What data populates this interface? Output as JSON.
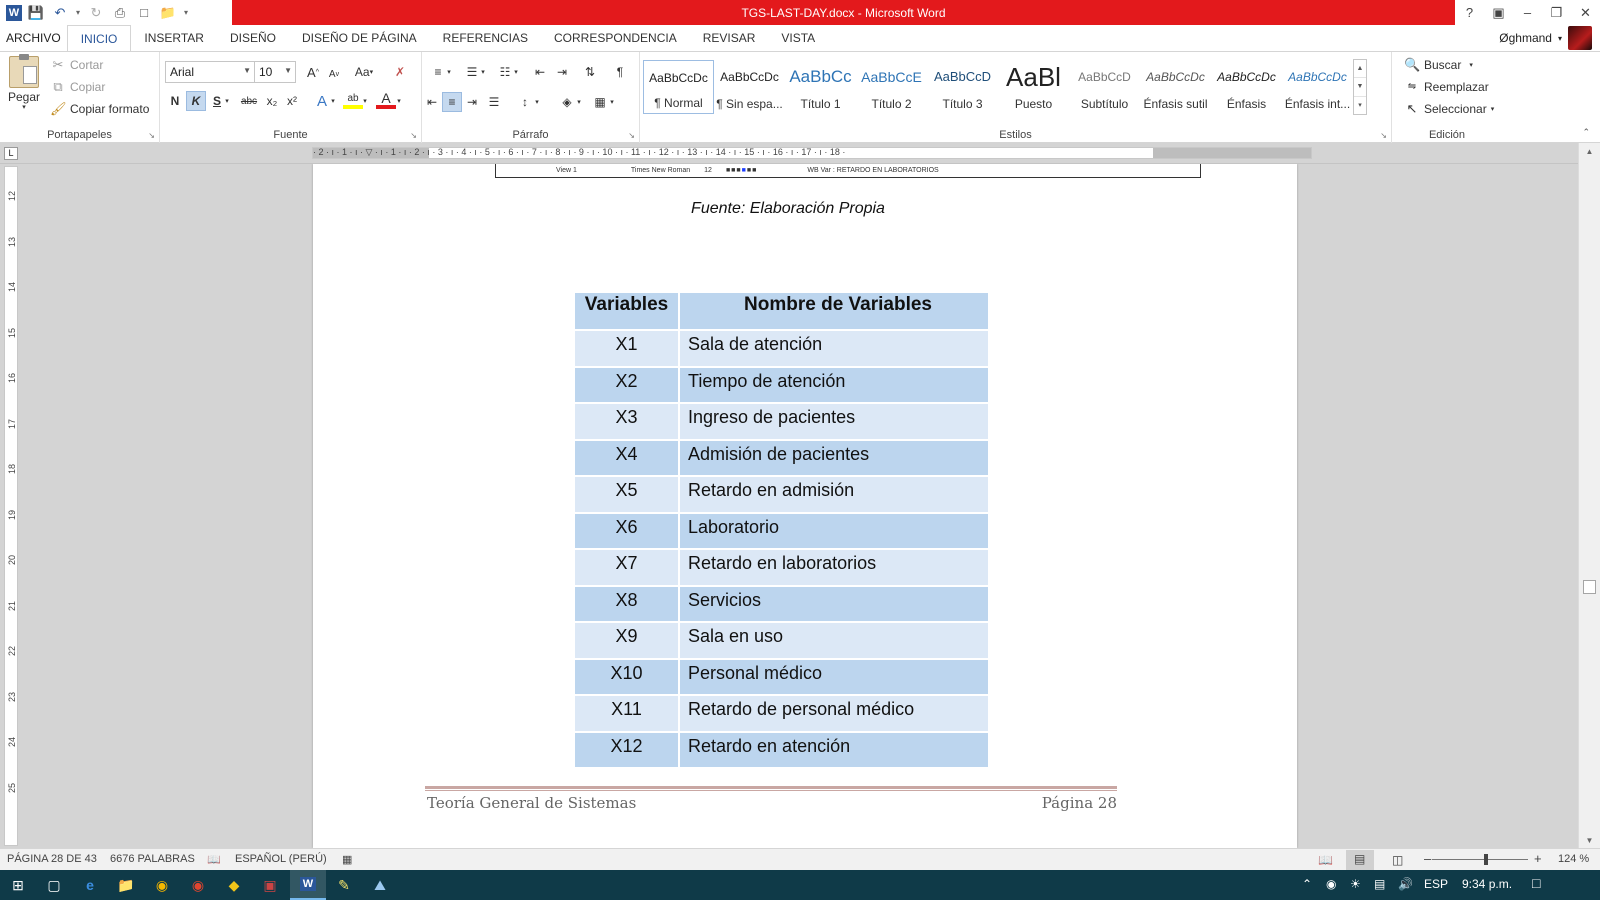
{
  "window": {
    "title": "TGS-LAST-DAY.docx - Microsoft Word",
    "help": "?",
    "user": "Øghmand"
  },
  "qat": {
    "word_icon": "W"
  },
  "tabs": [
    {
      "label": "ARCHIVO"
    },
    {
      "label": "INICIO"
    },
    {
      "label": "INSERTAR"
    },
    {
      "label": "DISEÑO"
    },
    {
      "label": "DISEÑO DE PÁGINA"
    },
    {
      "label": "REFERENCIAS"
    },
    {
      "label": "CORRESPONDENCIA"
    },
    {
      "label": "REVISAR"
    },
    {
      "label": "VISTA"
    }
  ],
  "ribbon": {
    "portapapeles": {
      "paste": "Pegar",
      "cut": "Cortar",
      "copy": "Copiar",
      "format_painter": "Copiar formato",
      "label": "Portapapeles"
    },
    "fuente": {
      "font_name": "Arial",
      "font_size": "10",
      "grow": "A",
      "shrink": "A",
      "case": "Aa",
      "bold": "N",
      "italic": "K",
      "underline": "S",
      "strike": "abc",
      "subscript": "x₂",
      "superscript": "x²",
      "effects": "A",
      "highlight": "ab",
      "color": "A",
      "label": "Fuente"
    },
    "parrafo": {
      "pilcrow": "¶",
      "label": "Párrafo"
    },
    "estilos": {
      "items": [
        {
          "sample": "AaBbCcDc",
          "name": "¶ Normal"
        },
        {
          "sample": "AaBbCcDc",
          "name": "¶ Sin espa..."
        },
        {
          "sample": "AaBbCc",
          "name": "Título 1"
        },
        {
          "sample": "AaBbCcE",
          "name": "Título 2"
        },
        {
          "sample": "AaBbCcD",
          "name": "Título 3"
        },
        {
          "sample": "AaBl",
          "name": "Puesto"
        },
        {
          "sample": "AaBbCcD",
          "name": "Subtítulo"
        },
        {
          "sample": "AaBbCcDc",
          "name": "Énfasis sutil"
        },
        {
          "sample": "AaBbCcDc",
          "name": "Énfasis"
        },
        {
          "sample": "AaBbCcDc",
          "name": "Énfasis int..."
        }
      ],
      "label": "Estilos"
    },
    "edicion": {
      "find": "Buscar",
      "replace": "Reemplazar",
      "select": "Seleccionar",
      "label": "Edición"
    }
  },
  "ruler": {
    "corner": "L",
    "numbers": "· 2 · ı · 1 · ı · ▽ · ı · 1 · ı · 2 · ı · 3 · ı · 4 · ı · 5 · ı · 6 · ı · 7 · ı · 8 · ı · 9 · ı · 10 · ı · 11 · ı · 12 · ı · 13 · ı · 14 · ı · 15 · ı · 16 · ı · 17 · ı · 18 ·",
    "vertical": [
      "12",
      "13",
      "14",
      "15",
      "16",
      "17",
      "18",
      "19",
      "20",
      "21",
      "22",
      "23",
      "24",
      "25"
    ]
  },
  "document": {
    "embedded_bar": {
      "view": "View 1",
      "font": "Times New Roman",
      "size": "12",
      "var": "WB Var : RETARDO EN LABORATORIOS"
    },
    "caption": "Fuente: Elaboración Propia",
    "table": {
      "headers": [
        "Variables",
        "Nombre de Variables"
      ],
      "rows": [
        [
          "X1",
          "Sala de atención"
        ],
        [
          "X2",
          "Tiempo de atención"
        ],
        [
          "X3",
          "Ingreso de pacientes"
        ],
        [
          "X4",
          "Admisión de pacientes"
        ],
        [
          "X5",
          "Retardo en admisión"
        ],
        [
          "X6",
          "Laboratorio"
        ],
        [
          "X7",
          "Retardo en laboratorios"
        ],
        [
          "X8",
          "Servicios"
        ],
        [
          "X9",
          "Sala en uso"
        ],
        [
          "X10",
          "Personal médico"
        ],
        [
          "X11",
          "Retardo de personal médico"
        ],
        [
          "X12",
          "Retardo en atención"
        ]
      ]
    },
    "footer": {
      "left": "Teoría General de Sistemas",
      "right": "Página 28"
    }
  },
  "statusbar": {
    "page": "PÁGINA 28 DE 43",
    "words": "6676 PALABRAS",
    "language": "ESPAÑOL (PERÚ)",
    "zoom": "124 %"
  },
  "taskbar": {
    "lang": "ESP",
    "time": "9:34 p.m."
  },
  "colors": {
    "title_red": "#e3191c",
    "accent": "#2b579a",
    "table_dark": "#bcd5ee",
    "table_light": "#dce8f6",
    "taskbar": "#0f3a48"
  }
}
